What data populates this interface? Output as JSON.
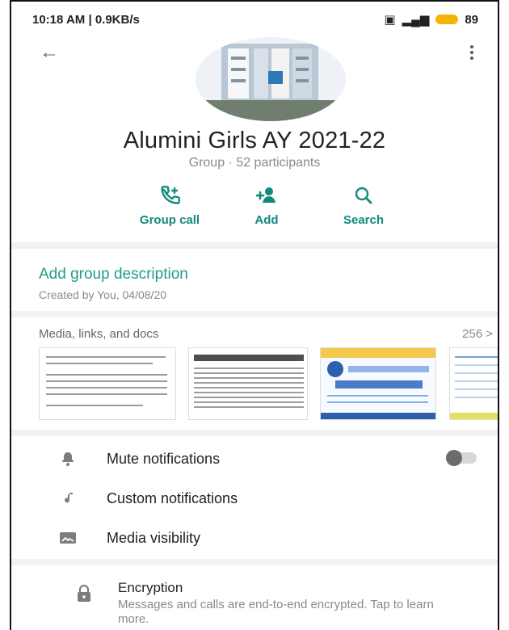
{
  "status_bar": {
    "left": "10:18 AM | 0.9KB/s",
    "right_battery": "89"
  },
  "group": {
    "name": "Alumini Girls AY 2021-22",
    "subtitle": "Group · 52 participants"
  },
  "actions": [
    {
      "label": "Group call",
      "icon": "group-call-icon"
    },
    {
      "label": "Add",
      "icon": "add-person-icon"
    },
    {
      "label": "Search",
      "icon": "search-icon"
    }
  ],
  "description": {
    "link": "Add group description",
    "created": "Created by You, 04/08/20"
  },
  "media": {
    "title": "Media, links, and docs",
    "count": "256 >"
  },
  "settings": [
    {
      "label": "Mute notifications",
      "icon": "bell-icon"
    },
    {
      "label": "Custom notifications",
      "icon": "music-note-icon"
    },
    {
      "label": "Media visibility",
      "icon": "media-visibility-icon"
    }
  ],
  "encryption": {
    "title": "Encryption",
    "description": "Messages and calls are end-to-end encrypted. Tap to learn more."
  },
  "colors": {
    "accent": "#1f9d87",
    "text": "#222222",
    "muted": "#8a8a8a"
  }
}
